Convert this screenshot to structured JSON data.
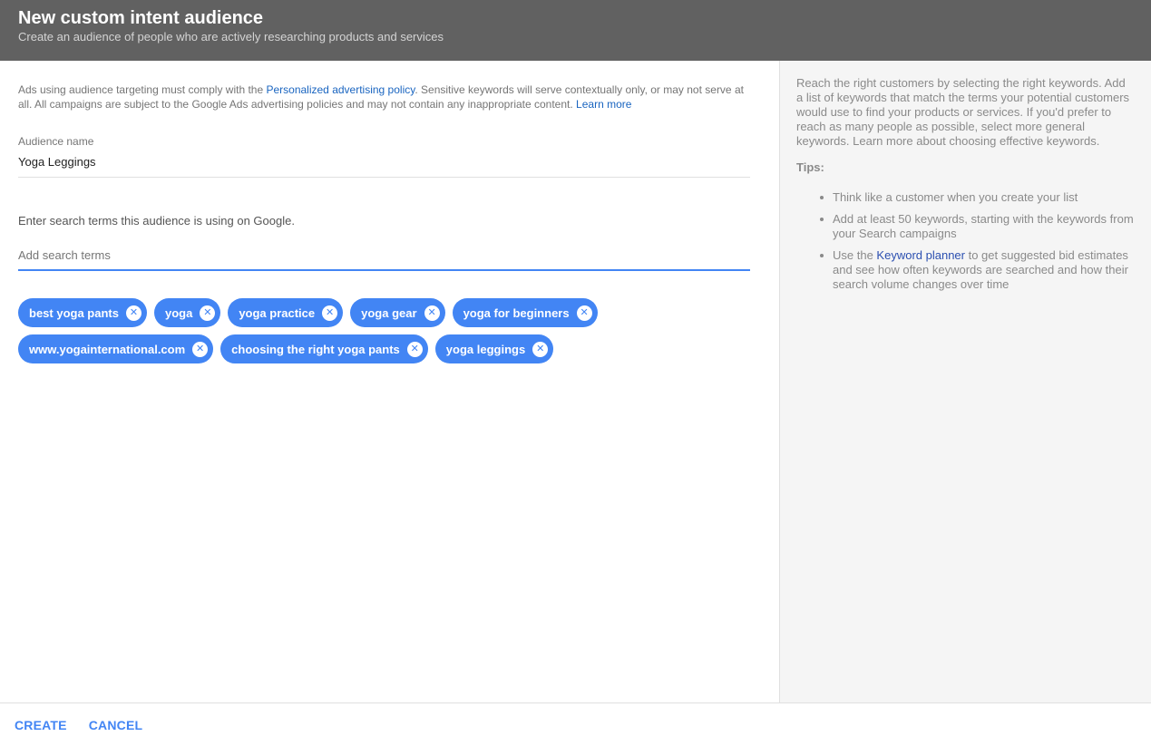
{
  "header": {
    "title": "New custom intent audience",
    "subtitle": "Create an audience of people who are actively researching products and services"
  },
  "notice": {
    "prefix": "Ads using audience targeting must comply with the ",
    "policy_link": "Personalized advertising policy",
    "middle": ". Sensitive keywords will serve contextually only, or may not serve at all. All campaigns are subject to the Google Ads advertising policies and may not contain any inappropriate content. ",
    "learn_more": "Learn more"
  },
  "audience_name": {
    "label": "Audience name",
    "value": "Yoga Leggings"
  },
  "search_terms": {
    "instruction": "Enter search terms this audience is using on Google.",
    "placeholder": "Add search terms",
    "chips": [
      "best yoga pants",
      "yoga",
      "yoga practice",
      "yoga gear",
      "yoga for beginners",
      "www.yogainternational.com",
      "choosing the right yoga pants",
      "yoga leggings"
    ]
  },
  "side": {
    "intro": "Reach the right customers by selecting the right keywords. Add a list of keywords that match the terms your potential customers would use to find your products or services. If you'd prefer to reach as many people as possible, select more general keywords. Learn more about choosing effective keywords.",
    "tips_title": "Tips:",
    "tip1": "Think like a customer when you create your list",
    "tip2": "Add at least 50 keywords, starting with the keywords from your Search campaigns",
    "tip3_prefix": "Use the ",
    "tip3_link": "Keyword planner",
    "tip3_suffix": " to get suggested bid estimates and see how often keywords are searched and how their search volume changes over time"
  },
  "footer": {
    "create_label": "CREATE",
    "cancel_label": "CANCEL"
  },
  "icons": {
    "chip_remove": "close-circle-icon"
  },
  "colors": {
    "header_bg": "#616161",
    "accent": "#4285f4",
    "link": "#1a65c0",
    "side_bg": "#f5f5f5"
  }
}
